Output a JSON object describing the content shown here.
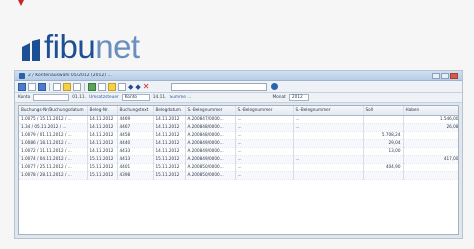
{
  "logo": {
    "text_main": "fibu",
    "text_accent": "net"
  },
  "window": {
    "title": "2 / Kontenauswahl 05/2012 (2012) ..."
  },
  "filter": {
    "konto_label": "Konto",
    "konto_value": "",
    "period_label": "01.11.",
    "link1": "Umsatzsteuer",
    "link2": "Konto",
    "mid_text": "14.11.",
    "status_text": "Summe ...",
    "right_label": "Monat",
    "right_value": "2012"
  },
  "grid": {
    "columns": [
      "Buchungs-Nr/Buchungsdatum",
      "Beleg-Nr.",
      "Buchungstext",
      "Belegdatum",
      "S.-Belegnummer",
      "S.-Belegnummer",
      "S.-Belegnummer",
      "Soll",
      "Haben"
    ],
    "rows": [
      [
        "1.0075 / 15.11.2012 / ...",
        "14.11.2012",
        "4469",
        "14.11.2012",
        "A.200847/0000...",
        "...",
        "...",
        "",
        "1.546,00"
      ],
      [
        "1.34 / 05.11.2012 / ...",
        "14.11.2012",
        "4467",
        "14.11.2012",
        "A.200848/0000...",
        "...",
        "...",
        "",
        "26,08"
      ],
      [
        "1.0079 / 01.11.2012 / ...",
        "14.11.2012",
        "4458",
        "14.11.2012",
        "A.200848/0000...",
        "...",
        "",
        "5.708,24",
        ""
      ],
      [
        "1.0086 / 18.11.2012 / ...",
        "14.11.2012",
        "4440",
        "14.11.2012",
        "A.200849/0000...",
        "...",
        "",
        "29,04",
        ""
      ],
      [
        "1.0072 / 11.11.2012 / ...",
        "14.11.2012",
        "4433",
        "14.11.2012",
        "A.200849/0000...",
        "...",
        "",
        "13,00",
        ""
      ],
      [
        "1.0074 / 04.11.2012 / ...",
        "15.11.2012",
        "4413",
        "15.11.2012",
        "A.200849/0000...",
        "...",
        "...",
        "",
        "417,00"
      ],
      [
        "1.0077 / 25.11.2012 / ...",
        "15.11.2012",
        "4401",
        "15.11.2012",
        "A.200850/0000...",
        "...",
        "",
        "404,90",
        ""
      ],
      [
        "1.0078 / 28.11.2012 / ...",
        "15.11.2012",
        "4398",
        "15.11.2012",
        "A.200850/0000...",
        "...",
        "",
        "",
        ""
      ]
    ]
  }
}
